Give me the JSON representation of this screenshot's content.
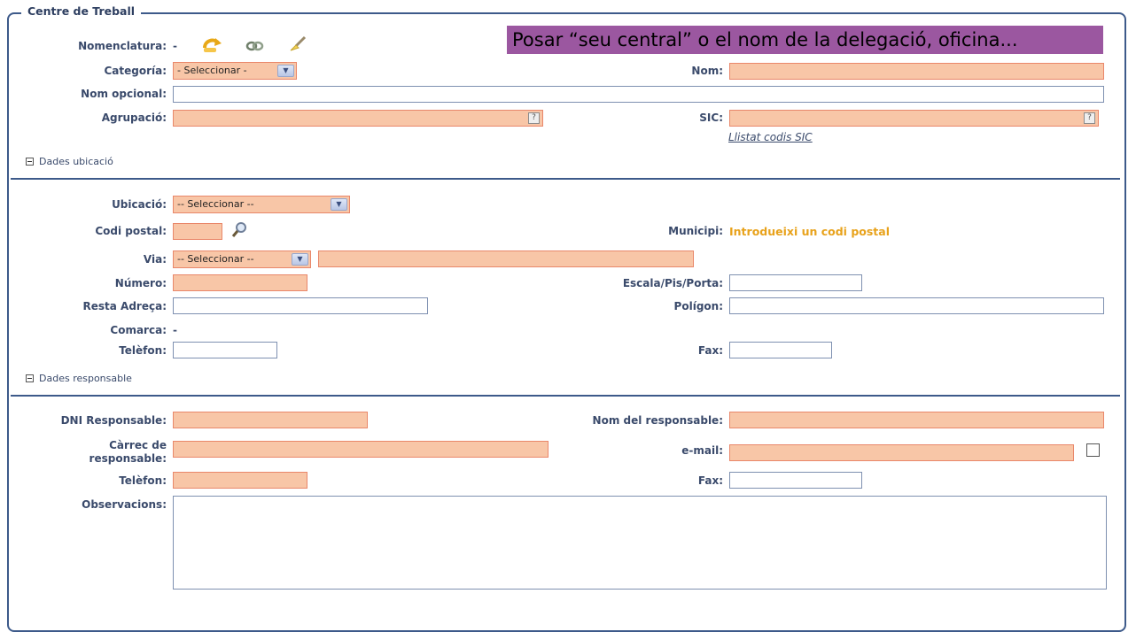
{
  "section_title": "Centre de Treball",
  "banner_text": "Posar “seu central” o el nom de la delegació, oficina...",
  "general": {
    "nomenclatura_label": "Nomenclatura:",
    "nomenclatura_value": "-",
    "categoria_label": "Categoría:",
    "categoria_selected": "- Seleccionar -",
    "nom_label": "Nom:",
    "nom_opcional_label": "Nom opcional:",
    "agrupacio_label": "Agrupació:",
    "sic_label": "SIC:",
    "sic_link": "Llistat codis SIC",
    "help_glyph": "?"
  },
  "ubicacio_section": {
    "toggle_label": "Dades ubicació",
    "ubicacio_label": "Ubicació:",
    "ubicacio_selected": "-- Seleccionar --",
    "codi_postal_label": "Codi postal:",
    "municipi_label": "Municipi:",
    "municipi_value": "Introdueixi un codi postal",
    "via_label": "Via:",
    "via_selected": "-- Seleccionar --",
    "numero_label": "Número:",
    "escala_label": "Escala/Pis/Porta:",
    "resta_label": "Resta Adreça:",
    "poligon_label": "Polígon:",
    "comarca_label": "Comarca:",
    "comarca_value": "-",
    "telefon_label": "Telèfon:",
    "fax_label": "Fax:"
  },
  "responsable_section": {
    "toggle_label": "Dades responsable",
    "dni_label": "DNI Responsable:",
    "nom_label": "Nom del responsable:",
    "carrec_label_1": "Càrrec de",
    "carrec_label_2": "responsable:",
    "email_label": "e-mail:",
    "telefon_label": "Telèfon:",
    "fax_label": "Fax:",
    "observacions_label": "Observacions:"
  },
  "icons": [
    "refresh-arrow-icon",
    "link-icon",
    "edit-brush-icon",
    "search-magnifier-icon"
  ],
  "colors": {
    "required_field": "#f8c6a7",
    "required_border": "#e9876a",
    "frame": "#3d5a8a",
    "banner": "#9b57a0",
    "municipi_text": "#e8a21b"
  }
}
